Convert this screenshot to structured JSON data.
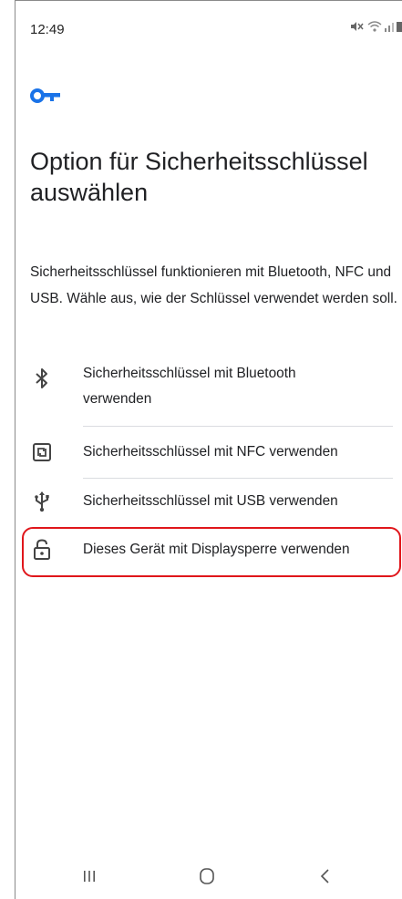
{
  "status_bar": {
    "time": "12:49",
    "icons": [
      "mute-icon",
      "wifi-icon",
      "signal-icon",
      "battery-icon"
    ]
  },
  "header": {
    "icon": "key-icon",
    "accent_color": "#1a73e8"
  },
  "title": "Option für Sicherheitsschlüssel auswählen",
  "description": "Sicherheitsschlüssel funktionieren mit Bluetooth, NFC und USB. Wähle aus, wie der Schlüssel verwendet werden soll.",
  "options": [
    {
      "icon": "bluetooth-icon",
      "label": "Sicherheitsschlüssel mit Bluetooth verwenden"
    },
    {
      "icon": "nfc-icon",
      "label": "Sicherheitsschlüssel mit NFC verwenden"
    },
    {
      "icon": "usb-icon",
      "label": "Sicherheitsschlüssel mit USB verwenden"
    },
    {
      "icon": "screen-lock-icon",
      "label": "Dieses Gerät mit Displaysperre verwenden",
      "highlighted": true
    }
  ],
  "highlight_color": "#e0161b",
  "nav_bar": {
    "buttons": [
      "recent-apps-icon",
      "home-icon",
      "back-icon"
    ]
  }
}
